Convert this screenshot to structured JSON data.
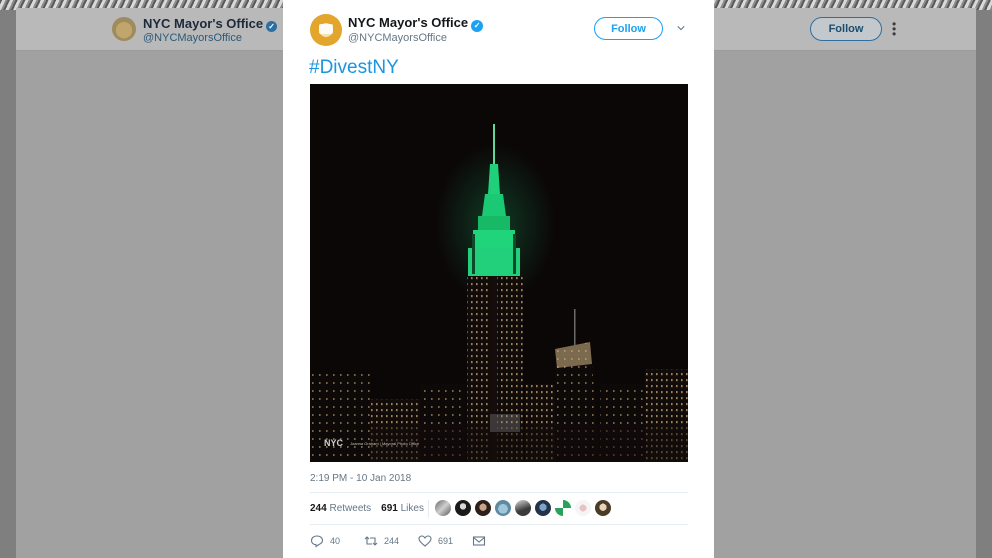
{
  "background": {
    "header": {
      "account_name": "NYC Mayor's Office",
      "handle": "@NYCMayorsOffice",
      "follow_label": "Follow"
    }
  },
  "tweet": {
    "account_name": "NYC Mayor's Office",
    "handle": "@NYCMayorsOffice",
    "follow_label": "Follow",
    "text": "#DivestNY",
    "photo": {
      "logo_text": "NYC",
      "credit_text": "Joanna Graham | Mayoral Photo Office"
    },
    "timestamp": "2:19 PM - 10 Jan 2018",
    "retweets_count": "244",
    "retweets_label": "Retweets",
    "likes_count": "691",
    "likes_label": "Likes",
    "actions": {
      "reply_count": "40",
      "retweet_count": "244",
      "like_count": "691"
    }
  },
  "colors": {
    "accent": "#1da1f2",
    "hashtag": "#1b95e0",
    "building_green": "#1fd47a"
  }
}
